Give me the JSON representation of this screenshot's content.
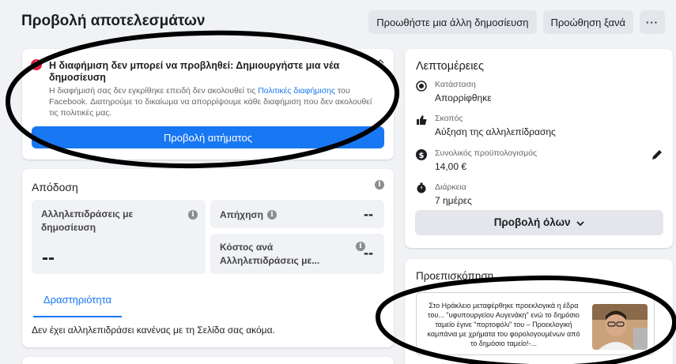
{
  "header": {
    "title": "Προβολή αποτελεσμάτων",
    "boost_another_label": "Προωθήστε μια άλλη δημοσίευση",
    "boost_again_label": "Προώθηση ξανά",
    "more_label": "···"
  },
  "alert": {
    "title": "Η διαφήμιση δεν μπορεί να προβληθεί: Δημιουργήστε μια νέα δημοσίευση",
    "desc_before": "Η διαφήμισή σας δεν εγκρίθηκε επειδή δεν ακολουθεί τις ",
    "desc_link": "Πολιτικές διαφήμισης",
    "desc_after": " του Facebook. Διατηρούμε το δικαίωμα να απορρίψουμε κάθε διαφήμιση που δεν ακολουθεί τις πολιτικές μας.",
    "button_label": "Προβολή αιτήματος",
    "icon": "!",
    "chevron": "^"
  },
  "performance": {
    "title": "Απόδοση",
    "metrics": [
      {
        "label": "Αλληλεπιδράσεις με δημοσίευση",
        "value": "--"
      },
      {
        "label": "Απήχηση",
        "value": "--"
      },
      {
        "label": "Κόστος ανά Αλληλεπιδράσεις με...",
        "value": "--"
      }
    ],
    "tab_label": "Δραστηριότητα",
    "empty_text": "Δεν έχει αλληλεπιδράσει κανένας με τη Σελίδα σας ακόμα."
  },
  "details": {
    "title": "Λεπτομέρειες",
    "items": [
      {
        "label": "Κατάσταση",
        "value": "Απορρίφθηκε",
        "icon": "status-icon"
      },
      {
        "label": "Σκοπός",
        "value": "Αύξηση της αλληλεπίδρασης",
        "icon": "thumbs-up-icon"
      },
      {
        "label": "Συνολικός προϋπολογισμός",
        "value": "14,00 €",
        "icon": "dollar-icon"
      },
      {
        "label": "Διάρκεια",
        "value": "7 ημέρες",
        "icon": "stopwatch-icon"
      }
    ],
    "view_all_label": "Προβολή όλων"
  },
  "preview": {
    "title": "Προεπισκόπηση",
    "post_text": "Στο Ηράκλειο μεταφέρθηκε προεκλογικά η έδρα του... \"υφυπουργείου Αυγενάκη\" ενώ το δημόσιο ταμείο έγινε \"πορτοφόλι\" του – Προεκλογική καμπάνια με χρήματα του φορολογουμένων από το δημόσιο ταμείο!-..."
  },
  "colors": {
    "accent": "#1877f2",
    "error": "#e41e3f",
    "background": "#f0f2f5"
  }
}
